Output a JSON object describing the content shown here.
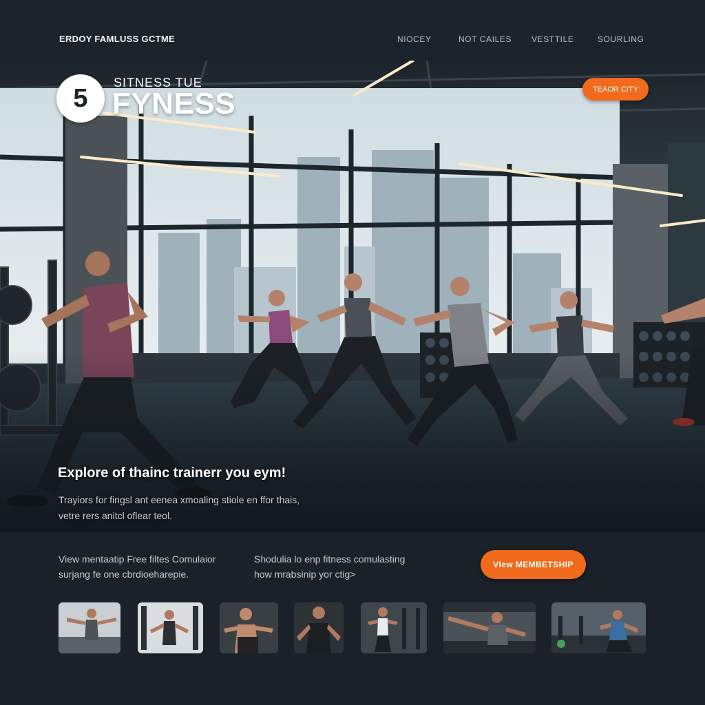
{
  "header": {
    "site_name": "ERDOY FAMLUSS GCTME",
    "nav": [
      "NIOCEY",
      "NOT CAILES",
      "VESTTILE",
      "SOURLING"
    ]
  },
  "hero": {
    "badge_number": "5",
    "logo_subtitle": "SITNESS TUE",
    "logo_title": "FYNESS",
    "cta_label": "TEAOR CITY",
    "heading": "Explore of thainc trainerr you eym!",
    "description": [
      "Trayiors for fingsl ant eenea xmoaling stiole en ffor thais,",
      "vetre rers anitcl oflear teol."
    ]
  },
  "promo": {
    "column_1": [
      "View mentaatip Free filtes Comulaior",
      "surjang fe one cbrdioeharepie."
    ],
    "column_2": [
      "Shodulia lo enp fitness comulasting",
      "how mrabsinip yor ctig>"
    ],
    "cta_label": "VIew MEMBETSHIP"
  },
  "thumbnails": [
    "trainer-thumb-1",
    "trainer-thumb-2",
    "trainer-thumb-3",
    "trainer-thumb-4",
    "trainer-thumb-5",
    "trainer-thumb-6",
    "trainer-thumb-7"
  ],
  "colors": {
    "accent": "#f26a1b",
    "background": "#1a2129",
    "header": "#1b242c"
  }
}
